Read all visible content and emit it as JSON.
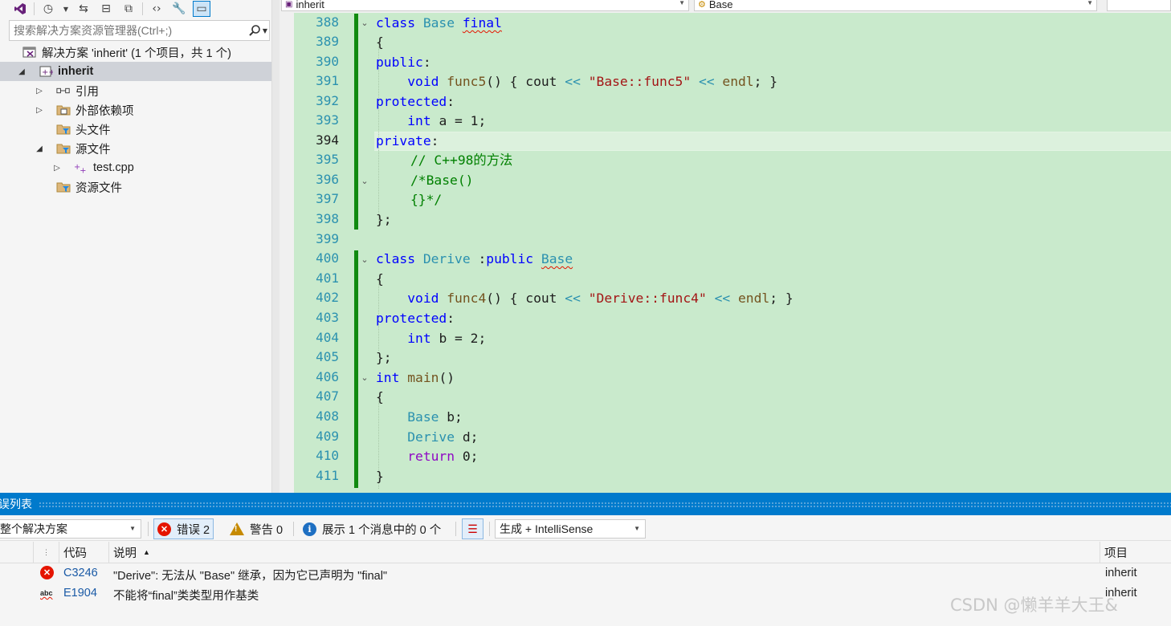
{
  "solution_explorer": {
    "search_placeholder": "搜索解决方案资源管理器(Ctrl+;)",
    "solution_label": "解决方案 'inherit' (1 个项目，共 1 个)",
    "tree": [
      {
        "label": "inherit",
        "icon": "project-icon"
      },
      {
        "label": "引用",
        "icon": "references-icon"
      },
      {
        "label": "外部依赖项",
        "icon": "external-deps-icon"
      },
      {
        "label": "头文件",
        "icon": "filter-folder-icon"
      },
      {
        "label": "源文件",
        "icon": "filter-folder-icon"
      },
      {
        "label": "test.cpp",
        "icon": "cpp-file-icon"
      },
      {
        "label": "资源文件",
        "icon": "filter-folder-icon"
      }
    ]
  },
  "editor": {
    "nav_project": "inherit",
    "nav_scope": "Base",
    "current_line": 394,
    "line_numbers": [
      "388",
      "389",
      "390",
      "391",
      "392",
      "393",
      "394",
      "395",
      "396",
      "397",
      "398",
      "399",
      "400",
      "401",
      "402",
      "403",
      "404",
      "405",
      "406",
      "407",
      "408",
      "409",
      "410",
      "411"
    ],
    "code": {
      "l388": {
        "kw_class": "class",
        "ty": "Base",
        "kw_final": "final"
      },
      "l389": "{",
      "l390": {
        "kw": "public",
        "rest": ":"
      },
      "l391": {
        "kw_void": "void",
        "fn": "func5",
        "p1": "() { cout ",
        "op1": "<<",
        "st": "\"Base::func5\"",
        "op2": "<<",
        "fn2": "endl",
        "p2": "; }"
      },
      "l392": {
        "kw": "protected",
        "rest": ":"
      },
      "l393": {
        "kw": "int",
        "rest": " a = 1;"
      },
      "l394": {
        "kw": "private",
        "rest": ":"
      },
      "l395": "// C++98的方法",
      "l396": "/*Base()",
      "l397": "{}*/",
      "l398": "};",
      "l400": {
        "kw_class": "class",
        "ty": "Derive",
        "p": " :",
        "kw_public": "public",
        "ty2": "Base"
      },
      "l401": "{",
      "l402": {
        "kw_void": "void",
        "fn": "func4",
        "p1": "() { cout ",
        "op1": "<<",
        "st": "\"Derive::func4\"",
        "op2": "<<",
        "fn2": "endl",
        "p2": "; }"
      },
      "l403": {
        "kw": "protected",
        "rest": ":"
      },
      "l404": {
        "kw": "int",
        "rest": " b = 2;"
      },
      "l405": "};",
      "l406": {
        "kw": "int",
        "fn": "main",
        "rest": "()"
      },
      "l407": "{",
      "l408": {
        "ty": "Base",
        "rest": " b;"
      },
      "l409": {
        "ty": "Derive",
        "rest": " d;"
      },
      "l410": {
        "kw": "return",
        "rest": " 0;"
      },
      "l411": "}"
    }
  },
  "error_list": {
    "title": "误列表",
    "scope": "整个解决方案",
    "errors_btn": "错误 2",
    "warnings_btn": "警告 0",
    "messages_btn": "展示 1 个消息中的 0 个",
    "source": "生成 + IntelliSense",
    "columns": {
      "code": "代码",
      "desc": "说明",
      "project": "项目"
    },
    "rows": [
      {
        "code": "C3246",
        "desc": "\"Derive\": 无法从 \"Base\" 继承，因为它已声明为 \"final\"",
        "project": "inherit",
        "icon": "error-icon"
      },
      {
        "code": "E1904",
        "desc": "不能将“final”类类型用作基类",
        "project": "inherit",
        "icon": "intellisense-error-icon"
      }
    ]
  },
  "watermark": "CSDN @懒羊羊大王&",
  "colors": {
    "accent": "#007acc",
    "editor_bg": "#c9eacc",
    "keyword": "#0000ff",
    "type": "#2b91af",
    "string": "#a31515",
    "comment": "#008000",
    "error": "#e51400"
  }
}
